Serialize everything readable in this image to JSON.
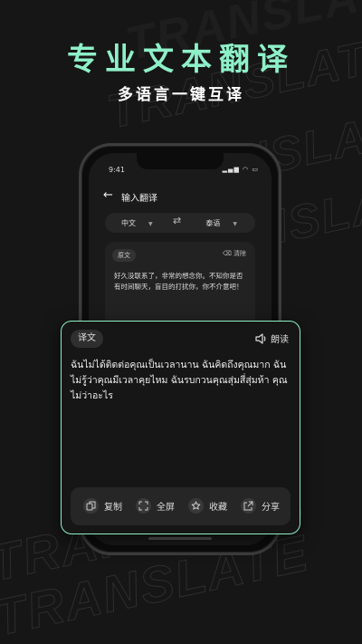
{
  "promo": {
    "headline": "专业文本翻译",
    "subheadline": "多语言一键互译",
    "bg_word": "TRANSLATE"
  },
  "status_bar": {
    "time": "9:41"
  },
  "header": {
    "title": "输入翻译"
  },
  "languages": {
    "source": "中文",
    "target": "泰语"
  },
  "source_panel": {
    "tag": "原文",
    "clear_label": "清除",
    "text": "好久没联系了，非常的想念你。不知你是否有时间聊天，盲目的打扰你，你不介意吧！"
  },
  "result_panel": {
    "tag": "译文",
    "read_label": "朗读",
    "text": "ฉันไม่ได้ติดต่อคุณเป็นเวลานาน ฉันคิดถึงคุณมาก ฉันไม่รู้ว่าคุณมีเวลาคุยไหม ฉันรบกวนคุณสุ่มสี่สุ่มห้า คุณไม่ว่าอะไร"
  },
  "actions": {
    "copy": "复制",
    "fullscreen": "全屏",
    "favorite": "收藏",
    "share": "分享"
  },
  "colors": {
    "accent": "#8ef0c8",
    "background": "#161616"
  }
}
